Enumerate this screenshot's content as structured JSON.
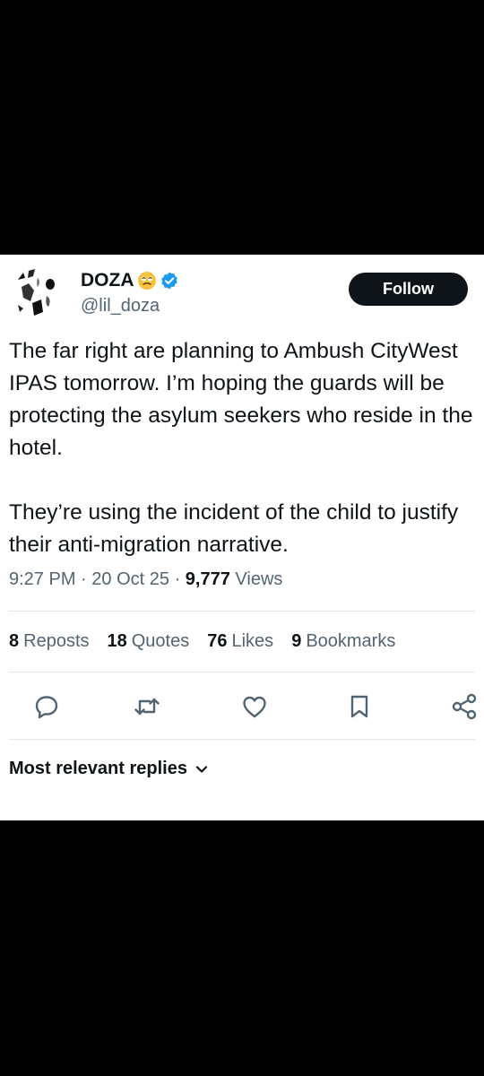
{
  "tweet": {
    "author_name": "DOZA",
    "handle": "@lil_doza",
    "follow_label": "Follow",
    "text": "The far right are planning to Ambush CityWest IPAS tomorrow. I’m hoping the guards will be protecting the asylum seekers who reside in the hotel.\n\nThey’re using the incident of the child to justify their anti-migration narrative.",
    "time": "9:27 PM",
    "date": "20 Oct 25",
    "views_count": "9,777",
    "views_label": "Views",
    "separator": "·"
  },
  "stats": [
    {
      "count": "8",
      "label": "Reposts"
    },
    {
      "count": "18",
      "label": "Quotes"
    },
    {
      "count": "76",
      "label": "Likes"
    },
    {
      "count": "9",
      "label": "Bookmarks"
    }
  ],
  "actions": [
    "reply-icon",
    "repost-icon",
    "like-icon",
    "bookmark-icon",
    "share-icon"
  ],
  "replies": {
    "sort_label": "Most relevant replies"
  },
  "colors": {
    "verified_badge": "#1d9bf0",
    "text_primary": "#0f1419",
    "text_secondary": "#536471",
    "follow_button_bg": "#0f1419",
    "action_icons": "#536471"
  }
}
